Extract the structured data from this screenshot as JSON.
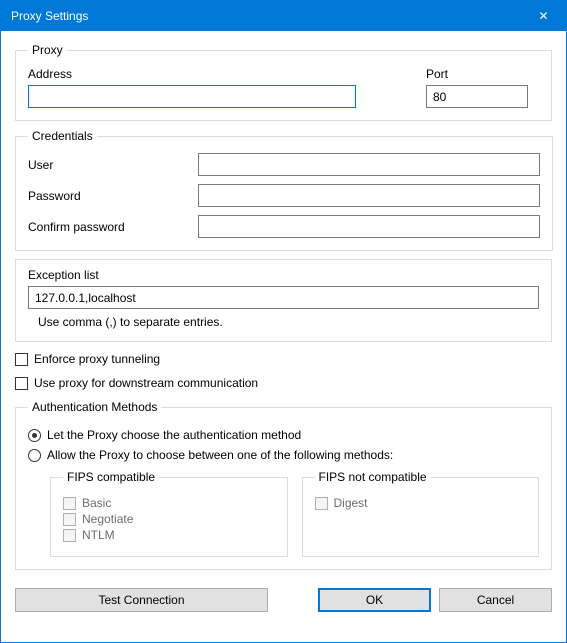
{
  "titlebar": {
    "title": "Proxy Settings",
    "close": "✕"
  },
  "proxy": {
    "legend": "Proxy",
    "address_label": "Address",
    "address_value": "",
    "port_label": "Port",
    "port_value": "80"
  },
  "credentials": {
    "legend": "Credentials",
    "user_label": "User",
    "user_value": "",
    "password_label": "Password",
    "password_value": "",
    "confirm_label": "Confirm password",
    "confirm_value": ""
  },
  "exception": {
    "label": "Exception list",
    "value": "127.0.0.1,localhost",
    "hint": "Use comma (,) to separate entries."
  },
  "enforce_tunnel_label": "Enforce proxy tunneling",
  "downstream_label": "Use proxy for downstream communication",
  "auth": {
    "legend": "Authentication Methods",
    "opt_auto": "Let the Proxy choose the authentication method",
    "opt_choose": "Allow the Proxy to choose between one of the following methods:",
    "fips_compat_legend": "FIPS compatible",
    "fips_not_legend": "FIPS not compatible",
    "basic": "Basic",
    "negotiate": "Negotiate",
    "ntlm": "NTLM",
    "digest": "Digest"
  },
  "buttons": {
    "test": "Test Connection",
    "ok": "OK",
    "cancel": "Cancel"
  }
}
